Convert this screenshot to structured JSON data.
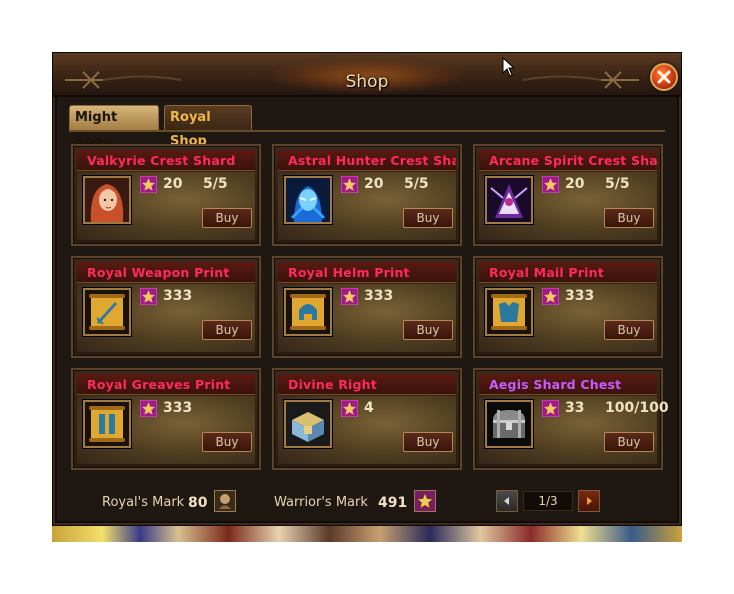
{
  "window": {
    "title": "Shop"
  },
  "tabs": [
    {
      "label": "Might Shop",
      "active": true
    },
    {
      "label": "Royal Shop",
      "active": false
    }
  ],
  "buy_label": "Buy",
  "items": [
    {
      "name": "Valkyrie Crest Shard",
      "name_color": "#ff2a5a",
      "icon": "valkyrie-portrait-icon",
      "price": "20",
      "limit": "5/5"
    },
    {
      "name": "Astral Hunter Crest Shard",
      "name_color": "#ff2a5a",
      "icon": "astral-hunter-portrait-icon",
      "price": "20",
      "limit": "5/5"
    },
    {
      "name": "Arcane Spirit Crest Shard",
      "name_color": "#ff2a5a",
      "icon": "arcane-spirit-portrait-icon",
      "price": "20",
      "limit": "5/5"
    },
    {
      "name": "Royal Weapon Print",
      "name_color": "#ff2a5a",
      "icon": "weapon-scroll-icon",
      "price": "333",
      "limit": ""
    },
    {
      "name": "Royal Helm Print",
      "name_color": "#ff2a5a",
      "icon": "helm-scroll-icon",
      "price": "333",
      "limit": ""
    },
    {
      "name": "Royal Mail Print",
      "name_color": "#ff2a5a",
      "icon": "mail-scroll-icon",
      "price": "333",
      "limit": ""
    },
    {
      "name": "Royal Greaves Print",
      "name_color": "#ff2a5a",
      "icon": "greaves-scroll-icon",
      "price": "333",
      "limit": ""
    },
    {
      "name": "Divine Right",
      "name_color": "#ff2a5a",
      "icon": "divine-right-chest-icon",
      "price": "4",
      "limit": ""
    },
    {
      "name": "Aegis Shard Chest",
      "name_color": "#c65cff",
      "icon": "treasure-chest-icon",
      "price": "33",
      "limit": "100/100"
    }
  ],
  "footer": {
    "royal_mark_label": "Royal's Mark",
    "royal_mark_value": "80",
    "warrior_mark_label": "Warrior's Mark",
    "warrior_mark_value": "491",
    "page": "1/3"
  }
}
